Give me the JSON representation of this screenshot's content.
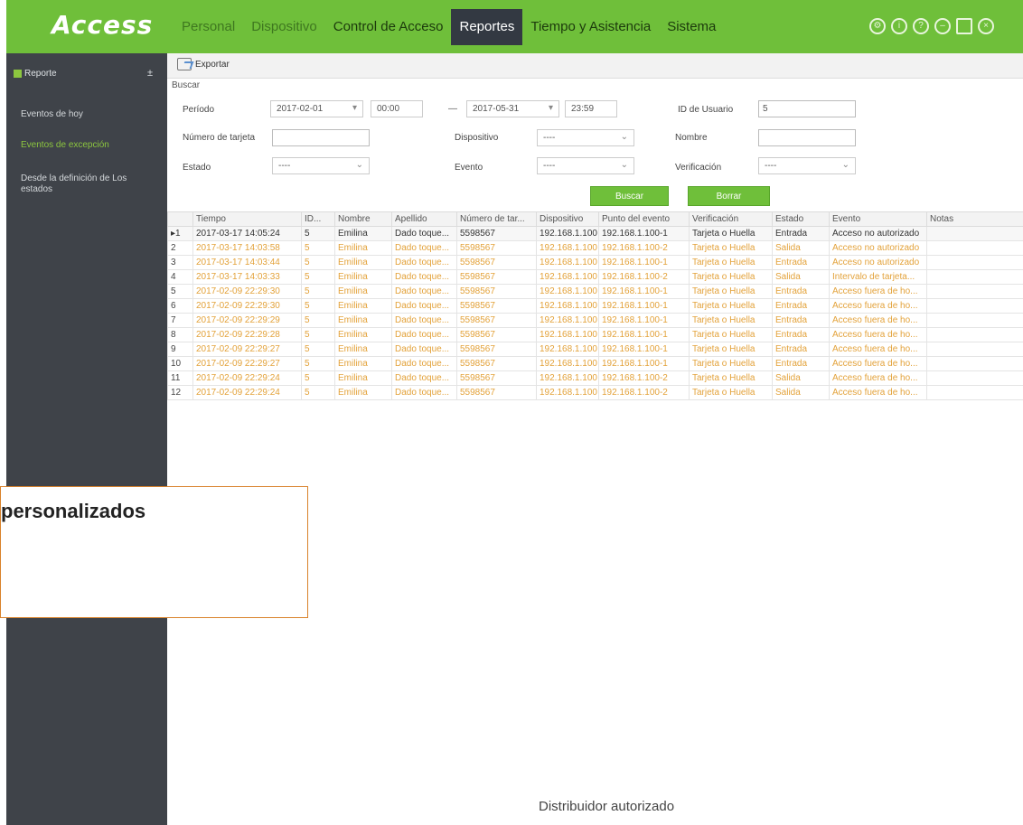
{
  "app": {
    "logo": "Access"
  },
  "nav": [
    {
      "label": "Personal",
      "state": "dim"
    },
    {
      "label": "Dispositivo",
      "state": "dim"
    },
    {
      "label": "Control de Acceso",
      "state": ""
    },
    {
      "label": "Reportes",
      "state": "active"
    },
    {
      "label": "Tiempo y Asistencia",
      "state": ""
    },
    {
      "label": "Sistema",
      "state": ""
    }
  ],
  "top_icons": [
    "gear-icon",
    "info-icon",
    "help-icon",
    "minimize-icon",
    "maximize-icon",
    "close-icon"
  ],
  "sidebar": {
    "header": "Reporte",
    "toggle": "±",
    "items": [
      {
        "label": "Eventos de hoy",
        "active": false
      },
      {
        "label": "Eventos de excepción",
        "active": true
      },
      {
        "label": "Desde la definición de Los estados",
        "active": false
      }
    ]
  },
  "toolbar": {
    "export_label": "Exportar"
  },
  "search": {
    "title": "Buscar",
    "periodo_label": "Período",
    "date_from": "2017-02-01",
    "time_from": "00:00",
    "range_sep": "—",
    "date_to": "2017-05-31",
    "time_to": "23:59",
    "user_id_label": "ID de Usuario",
    "user_id_value": "5",
    "card_label": "Número de tarjeta",
    "card_value": "",
    "device_label": "Dispositivo",
    "device_value": "----",
    "name_label": "Nombre",
    "name_value": "",
    "state_label": "Estado",
    "state_value": "----",
    "event_label": "Evento",
    "event_value": "----",
    "verif_label": "Verificación",
    "verif_value": "----",
    "search_button": "Buscar",
    "clear_button": "Borrar"
  },
  "table": {
    "columns": [
      "",
      "Tiempo",
      "ID...",
      "Nombre",
      "Apellido",
      "Número de tar...",
      "Dispositivo",
      "Punto del evento",
      "Verificación",
      "Estado",
      "Evento",
      "Notas"
    ],
    "rows": [
      [
        "▸1",
        "2017-03-17 14:05:24",
        "5",
        "Emilina",
        "Dado toque...",
        "5598567",
        "192.168.1.100",
        "192.168.1.100-1",
        "Tarjeta o Huella",
        "Entrada",
        "Acceso no autorizado",
        ""
      ],
      [
        "2",
        "2017-03-17 14:03:58",
        "5",
        "Emilina",
        "Dado toque...",
        "5598567",
        "192.168.1.100",
        "192.168.1.100-2",
        "Tarjeta o Huella",
        "Salida",
        "Acceso no autorizado",
        ""
      ],
      [
        "3",
        "2017-03-17 14:03:44",
        "5",
        "Emilina",
        "Dado toque...",
        "5598567",
        "192.168.1.100",
        "192.168.1.100-1",
        "Tarjeta o Huella",
        "Entrada",
        "Acceso no autorizado",
        ""
      ],
      [
        "4",
        "2017-03-17 14:03:33",
        "5",
        "Emilina",
        "Dado toque...",
        "5598567",
        "192.168.1.100",
        "192.168.1.100-2",
        "Tarjeta o Huella",
        "Salida",
        "Intervalo de tarjeta...",
        ""
      ],
      [
        "5",
        "2017-02-09 22:29:30",
        "5",
        "Emilina",
        "Dado toque...",
        "5598567",
        "192.168.1.100",
        "192.168.1.100-1",
        "Tarjeta o Huella",
        "Entrada",
        "Acceso fuera de ho...",
        ""
      ],
      [
        "6",
        "2017-02-09 22:29:30",
        "5",
        "Emilina",
        "Dado toque...",
        "5598567",
        "192.168.1.100",
        "192.168.1.100-1",
        "Tarjeta o Huella",
        "Entrada",
        "Acceso fuera de ho...",
        ""
      ],
      [
        "7",
        "2017-02-09 22:29:29",
        "5",
        "Emilina",
        "Dado toque...",
        "5598567",
        "192.168.1.100",
        "192.168.1.100-1",
        "Tarjeta o Huella",
        "Entrada",
        "Acceso fuera de ho...",
        ""
      ],
      [
        "8",
        "2017-02-09 22:29:28",
        "5",
        "Emilina",
        "Dado toque...",
        "5598567",
        "192.168.1.100",
        "192.168.1.100-1",
        "Tarjeta o Huella",
        "Entrada",
        "Acceso fuera de ho...",
        ""
      ],
      [
        "9",
        "2017-02-09 22:29:27",
        "5",
        "Emilina",
        "Dado toque...",
        "5598567",
        "192.168.1.100",
        "192.168.1.100-1",
        "Tarjeta o Huella",
        "Entrada",
        "Acceso fuera de ho...",
        ""
      ],
      [
        "10",
        "2017-02-09 22:29:27",
        "5",
        "Emilina",
        "Dado toque...",
        "5598567",
        "192.168.1.100",
        "192.168.1.100-1",
        "Tarjeta o Huella",
        "Entrada",
        "Acceso fuera de ho...",
        ""
      ],
      [
        "11",
        "2017-02-09 22:29:24",
        "5",
        "Emilina",
        "Dado toque...",
        "5598567",
        "192.168.1.100",
        "192.168.1.100-2",
        "Tarjeta o Huella",
        "Salida",
        "Acceso fuera de ho...",
        ""
      ],
      [
        "12",
        "2017-02-09 22:29:24",
        "5",
        "Emilina",
        "Dado toque...",
        "5598567",
        "192.168.1.100",
        "192.168.1.100-2",
        "Tarjeta o Huella",
        "Salida",
        "Acceso fuera de ho...",
        ""
      ]
    ]
  },
  "overlay": {
    "text": "personalizados"
  },
  "footer": {
    "note": "Distribuidor autorizado"
  },
  "colors": {
    "brand_green": "#6fbf3a",
    "sidebar": "#3f4349",
    "row_text": "#e3a23a",
    "overlay_border": "#d9822b"
  }
}
